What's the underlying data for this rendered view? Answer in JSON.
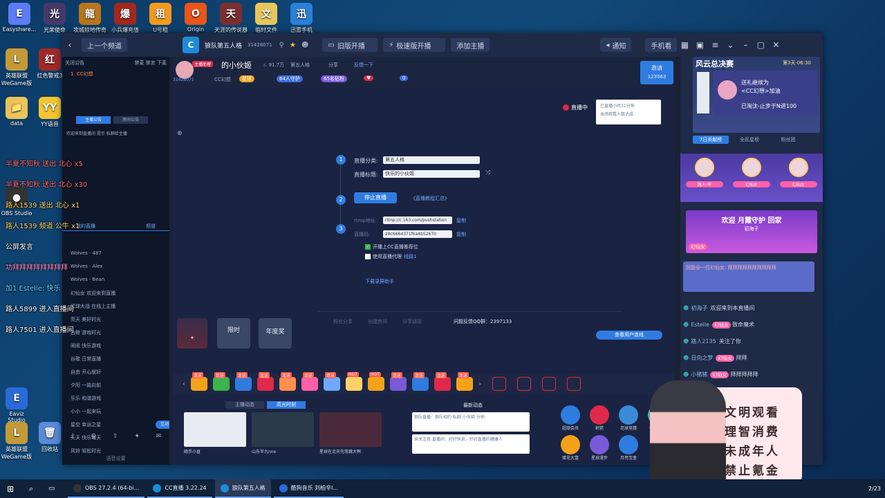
{
  "desktop": {
    "icons_top": [
      {
        "label": "Easyshare...",
        "color": "#5b7cf5",
        "glyph": "E"
      },
      {
        "label": "光荣使命",
        "color": "#443a6a",
        "glyph": "光"
      },
      {
        "label": "攻城掠地传奇",
        "color": "#b8751a",
        "glyph": "龍"
      },
      {
        "label": "小兵爆充值",
        "color": "#a4271b",
        "glyph": "爆"
      },
      {
        "label": "U号租",
        "color": "#f29a1f",
        "glyph": "租"
      },
      {
        "label": "Origin",
        "color": "#e8561a",
        "glyph": "O"
      },
      {
        "label": "天涯的传说器",
        "color": "#7b2f2f",
        "glyph": "天"
      },
      {
        "label": "临时文件",
        "color": "#e7c75a",
        "glyph": "文"
      },
      {
        "label": "迅雷手机",
        "color": "#2a80d8",
        "glyph": "迅"
      }
    ],
    "icons_left": [
      {
        "label": "英雄联盟WeGame版",
        "color": "#c49a39",
        "glyph": "L"
      },
      {
        "label": "红色警戒3",
        "color": "#a02a2a",
        "glyph": "红"
      },
      {
        "label": "data",
        "color": "#e9c45a",
        "glyph": "📁"
      },
      {
        "label": "YY语音",
        "color": "#f4c430",
        "glyph": "YY"
      },
      {
        "label": "OBS Studio",
        "color": "#333333",
        "glyph": "●"
      },
      {
        "label": "Eaviz Studio",
        "color": "#2a6ad8",
        "glyph": "E"
      },
      {
        "label": "英雄联盟WeGame版",
        "color": "#c49a39",
        "glyph": "L"
      },
      {
        "label": "回收站",
        "color": "#5a8ad8",
        "glyph": "🗑"
      }
    ]
  },
  "window": {
    "title_left": "上一个频道",
    "tab_room": "狼队第五人格",
    "room_id": "31428071",
    "btn_old_live": "旧版开播",
    "btn_fast_live": "极速版开播",
    "btn_add": "添加主播",
    "btn_notice": "通知",
    "btn_phone": "手机看"
  },
  "left_panel": {
    "header": "关闭公告",
    "header_right": "禁麦 禁言 下麦",
    "member": "1. CC幻想",
    "tab1": "主播公告",
    "tab2": "房间公告",
    "notice": "欢迎来到直播间 提示 私聊给主播",
    "tab3": "我的直播",
    "tab4": "频道",
    "items": [
      "Wolves · 487",
      "Wolves · Alex",
      "Wolves · Bean",
      "幻仙女 欢迎来到直播",
      "星球大战 在线上主播",
      "亮天 美好时光",
      "白鲸 游戏时光",
      "闹闹 快乐游戏",
      "谷歌 日常直播",
      "自由 开心就好",
      "夕阳 一路向前",
      "乐乐 和谐游戏",
      "小小 一起来玩",
      "星空 幸运之星",
      "天天 快乐每天",
      "风铃 轻松时光"
    ],
    "footer_btn": "互动机器",
    "footer": "语音设置"
  },
  "desktop_chat_overlay": {
    "lines": [
      "半夏不知秋 送出 北心 x5",
      "半夏不知秋 送出 北心 x30",
      "路人1539 送出 北心 x1",
      "路人1539 频道 公牛 x1",
      "公屏发言",
      "功拜拜拜拜拜拜拜拜",
      "加1  Estelle: 快乐",
      "路人5899 进入直播间",
      "路人7501 进入直播间"
    ]
  },
  "room": {
    "anchor_tag": "主播助理",
    "anchor_name": "的小伙姬",
    "heat": "91.7万",
    "category": "第五人格",
    "share": "分享",
    "report": "反馈一下",
    "sub_id": "31428071",
    "sub_cc": "CC幻想",
    "level_badge": "星球",
    "fans_badge": "64人守护",
    "guard_badge": "65名贴粉",
    "count_badge": "0",
    "invite": "邀请",
    "invite_num": "123963"
  },
  "stage": {
    "live_tag": "直播中",
    "live_info": "已直播小时31分钟",
    "live_info2": "本场观看人数达成",
    "label_category": "直播分类:",
    "value_category": "第五人格",
    "label_title": "直播标题:",
    "value_title": "快乐的小伙姬",
    "btn_stop": "停止直播",
    "tutorial": "《直播教程汇总》",
    "label_rtmp": "rtmp地址:",
    "value_rtmp": "rtmp://c.163.com/pushstation",
    "copy": "复制",
    "label_code": "直播码:",
    "value_code": "28c6664371f6a4b52670",
    "chk1": "开播上CC直播推荐位",
    "chk2": "使用直播代理",
    "chk2_link": "线路1",
    "download": "下载录屏助手",
    "tools": [
      "粉丝分享",
      "创建房间",
      "分享链接"
    ],
    "qq": "问题反馈QQ群：2397133",
    "btn_browser": "查看用户连线",
    "promo1": "限时",
    "promo2": "限时福利",
    "promo3": "年度奖"
  },
  "gift_tags": [
    "连送",
    "连送",
    "连送",
    "连送",
    "连送",
    "连送",
    "连送",
    "HOT",
    "HOT",
    "连送",
    "连送",
    "连送",
    "连送"
  ],
  "bottom": {
    "tab1": "主播动态",
    "tab2": "高光时刻",
    "tab3": "最新动态",
    "thumbs": [
      "随手小直",
      "山东半九nne",
      "星球在北天先常跳大鸭"
    ],
    "news1": "狼队直播：狼队相约 私聊 小伙姬 分钟",
    "news2": "来关注我 直播间：好好休息，好好直播的健康人",
    "apps": [
      "超级会员",
      "射箭",
      "足球竞猜",
      "召唤神龙",
      "蛋花大富",
      "星球漫步",
      "月亮宝盒"
    ]
  },
  "right_panel": {
    "banner_title": "风云总决赛",
    "banner_sub": "第3天·06:30",
    "gift_msg1": "送礼继续为",
    "gift_msg2": "<CC幻想>加油",
    "gift_msg3": "已淘汰-止步于N进100",
    "tabs": [
      "7日贡献榜",
      "全民星榜",
      "粉丝团"
    ],
    "ranks": [
      "路人·甲",
      "幻仙女",
      "幻仙女"
    ],
    "welcome_banner": "欢迎  月霞守护  回家",
    "welcome_name": "初海子",
    "welcome_badge": "幻仙女",
    "highlight_msg": "回复@一位幻仙女: 拜拜拜拜拜拜拜拜拜拜",
    "chat": [
      {
        "user": "初海子",
        "msg": "欢迎来到本直播间"
      },
      {
        "user": "Estelle",
        "badge": "幻仙女",
        "msg": "致命魔术"
      },
      {
        "user": "路人2135",
        "msg": "关注了你"
      },
      {
        "user": "日向之梦",
        "badge": "幻仙女",
        "msg": "拜拜"
      },
      {
        "user": "小猪猪",
        "badge": "幻仙女",
        "msg": "拜拜拜拜拜"
      }
    ]
  },
  "overlay": {
    "lines": [
      "文明观看",
      "理智消费",
      "未成年人",
      "禁止氪金"
    ]
  },
  "taskbar": {
    "tasks": [
      "OBS 27.2.4 (64-bi...",
      "CC直播 3.22.24",
      "狼队第五人格",
      "酷狗音乐 刘柏辛l..."
    ],
    "date": "2/23"
  },
  "colors": {
    "accent": "#2f7ce0",
    "live_red": "#e0294a",
    "pink": "#ff5fa8"
  }
}
